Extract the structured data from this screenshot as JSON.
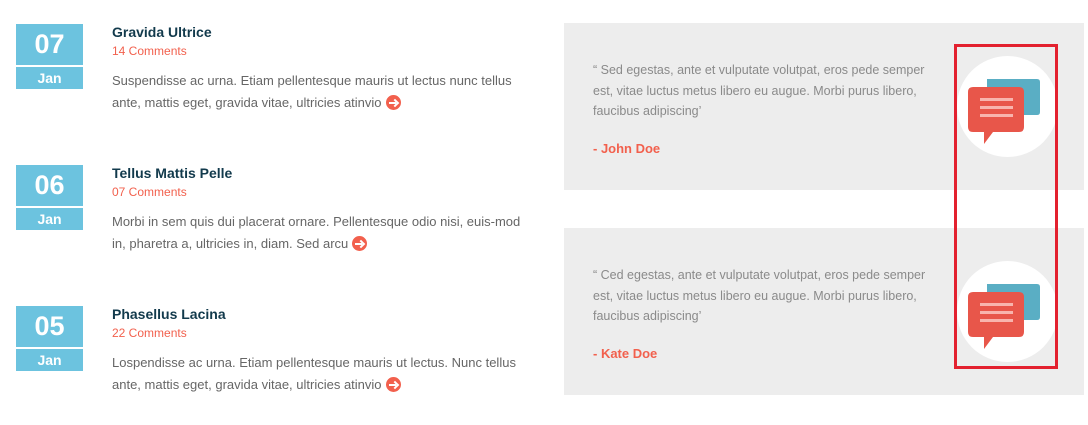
{
  "posts": [
    {
      "day": "07",
      "month": "Jan",
      "title": "Gravida Ultrice",
      "comments": "14 Comments",
      "excerpt": "Suspendisse ac urna. Etiam pellentesque mauris ut lectus nunc tellus ante, mattis eget, gravida vitae, ultricies atinvio"
    },
    {
      "day": "06",
      "month": "Jan",
      "title": "Tellus Mattis Pelle",
      "comments": "07 Comments",
      "excerpt": "Morbi in sem quis dui placerat ornare. Pellentesque odio nisi, euis-mod in, pharetra a, ultricies in, diam. Sed arcu"
    },
    {
      "day": "05",
      "month": "Jan",
      "title": "Phasellus Lacina",
      "comments": "22 Comments",
      "excerpt": "Lospendisse ac urna. Etiam pellentesque mauris ut lectus. Nunc tellus ante, mattis eget, gravida vitae, ultricies atinvio"
    }
  ],
  "testimonials": [
    {
      "quote": "“ Sed egestas, ante et vulputate volutpat, eros pede semper est, vitae luctus metus libero eu augue. Morbi purus libero, faucibus adipiscing’",
      "author": "- John Doe",
      "icon": "chat-bubbles-icon"
    },
    {
      "quote": "“ Ced egestas, ante et vulputate volutpat, eros pede semper est, vitae luctus metus libero eu augue. Morbi purus libero, faucibus adipiscing’",
      "author": "- Kate Doe",
      "icon": "chat-bubbles-icon"
    }
  ],
  "colors": {
    "date_box": "#6cc3df",
    "title": "#123a4c",
    "accent": "#f2604d",
    "testimonial_bg": "#ededed",
    "highlight": "#e3212f",
    "chat_back": "#5aaec4",
    "chat_front": "#e8564a"
  }
}
